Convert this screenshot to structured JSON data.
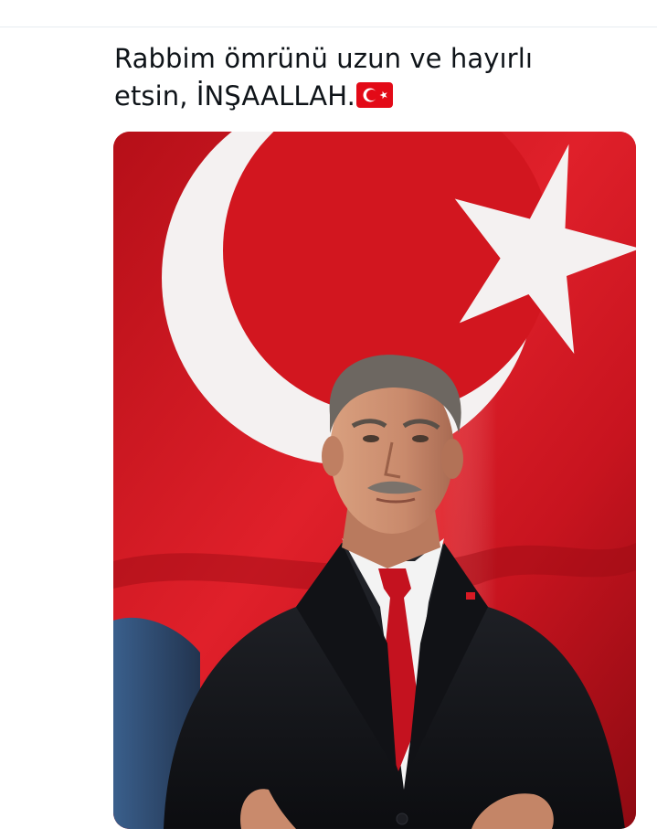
{
  "post": {
    "text_line1": "Rabbim ömrünü uzun ve hayırlı",
    "text_line2": "etsin, İNŞAALLAH."
  },
  "emoji": {
    "name": "turkish-flag-emoji",
    "colors": {
      "red": "#e30a17",
      "white": "#ffffff"
    }
  },
  "media": {
    "photo_subject": "man-in-suit-before-turkish-flag",
    "colors": {
      "flag_red": "#d0141f",
      "flag_dark_red": "#8e0a12",
      "crescent_white": "#f4f1f1",
      "suit": "#15171c",
      "tie": "#c4121f",
      "shirt": "#f3f3f3",
      "skin": "#c98a6c",
      "hair": "#6d6761"
    }
  }
}
